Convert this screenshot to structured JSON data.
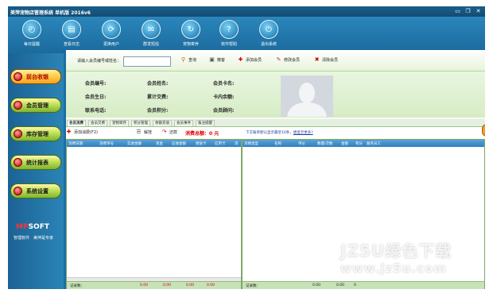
{
  "window": {
    "title": "美萍宠物店管理系统 单机版 2016v6",
    "controls": {
      "minimize": "▭",
      "maximize": "❐",
      "close": "✕"
    }
  },
  "toolbar": {
    "items": [
      {
        "label": "每日提醒",
        "icon": "clock-icon",
        "glyph": "◴"
      },
      {
        "label": "查看日志",
        "icon": "log-icon",
        "glyph": "▤"
      },
      {
        "label": "更换用户",
        "icon": "swap-user-icon",
        "glyph": "⟳"
      },
      {
        "label": "群发短信",
        "icon": "sms-icon",
        "glyph": "✉"
      },
      {
        "label": "宠物寄养",
        "icon": "pet-icon",
        "glyph": "↻"
      },
      {
        "label": "软件帮助",
        "icon": "help-icon",
        "glyph": "?"
      },
      {
        "label": "退出系统",
        "icon": "exit-icon",
        "glyph": "⏻"
      }
    ]
  },
  "sidebar": {
    "items": [
      {
        "label": "前台收银",
        "active": true
      },
      {
        "label": "会员管理",
        "active": false
      },
      {
        "label": "库存管理",
        "active": false
      },
      {
        "label": "统计报表",
        "active": false
      },
      {
        "label": "系统设置",
        "active": false
      }
    ],
    "logo_brand": "MP",
    "logo_rest": "SOFT",
    "logo_sub": "管理软件　美萍是专家"
  },
  "search": {
    "label": "请输入会员编号或姓名：",
    "value": "",
    "query_label": "查询",
    "list_label": "散客",
    "add_label": "添加会员",
    "edit_label": "修改会员",
    "clear_label": "清除会员"
  },
  "member_info": {
    "number_label": "会员编号:",
    "name_label": "会员姓名:",
    "card_name_label": "会员卡名:",
    "birthday_label": "会员生日:",
    "total_spend_label": "累计交费:",
    "card_balance_label": "卡内余额:",
    "phone_label": "联系电话:",
    "points_label": "会员积分:",
    "advisor_label": "会员顾问:"
  },
  "tabs": [
    "会员消费",
    "会员交费",
    "宠物寄存",
    "积分管理",
    "余额充值",
    "会员事件",
    "备注提醒"
  ],
  "actions": {
    "add_consume": "添加消费(F2)",
    "discount": "解挂",
    "return": "还款",
    "total": "消费总额：0 元",
    "hint_text": "下方账单默认显示最近10条，",
    "hint_link": "想显示更多?"
  },
  "left_table": {
    "columns": [
      "消费日期",
      "消费单号",
      "实收金额",
      "现金",
      "应收金额",
      "储值卡",
      "信用卡",
      "消"
    ],
    "footer": {
      "label": "记录数：",
      "values": [
        "0.00",
        "0.00",
        "0.00",
        "0.00"
      ]
    }
  },
  "right_table": {
    "columns": [
      "消费类型",
      "名称",
      "单价",
      "数量/次数",
      "金额",
      "积分",
      "服务员工"
    ],
    "footer": {
      "label": "记录数：",
      "values": [
        "0.00",
        "0.00",
        "0"
      ]
    }
  },
  "watermark": {
    "brand": "JZ5U绿色下载",
    "url": "www.jz5u.com"
  }
}
